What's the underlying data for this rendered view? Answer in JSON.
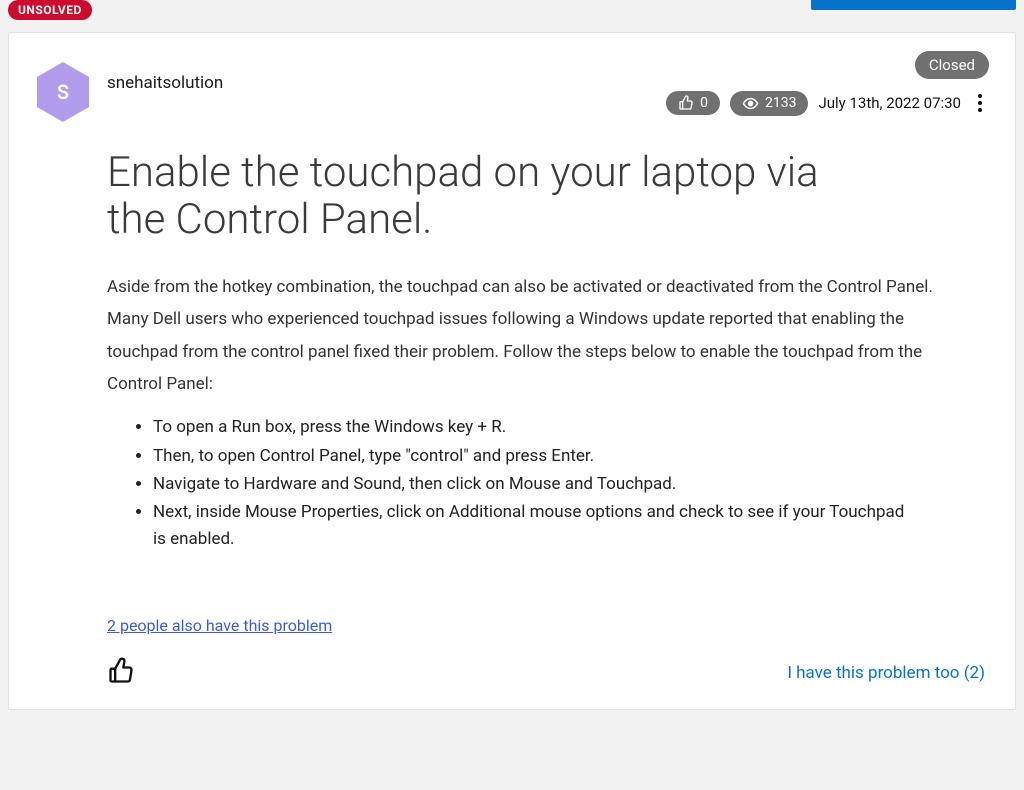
{
  "topbar": {
    "unsolved_label": "UNSOLVED"
  },
  "post": {
    "status_label": "Closed",
    "author": {
      "name": "snehaitsolution",
      "initial": "S"
    },
    "kudos_count": "0",
    "views_count": "2133",
    "timestamp": "July 13th, 2022 07:30",
    "title": "Enable the touchpad on your laptop via the Control Panel.",
    "intro": "Aside from the hotkey combination, the touchpad can also be activated or deactivated from the Control Panel. Many Dell users who experienced touchpad issues following a Windows update reported that enabling the touchpad from the control panel fixed their problem. Follow the steps below to enable the touchpad from the Control Panel:",
    "steps": [
      "To open a Run box, press the Windows key + R.",
      "Then, to open Control Panel, type \"control\" and press Enter.",
      "Navigate to Hardware and Sound, then click on Mouse and Touchpad.",
      "Next, inside Mouse Properties, click on Additional mouse options and check to see if your Touchpad is enabled."
    ],
    "also_have_link": "2 people also have this problem",
    "have_problem_label": "I have this problem too (2)"
  }
}
